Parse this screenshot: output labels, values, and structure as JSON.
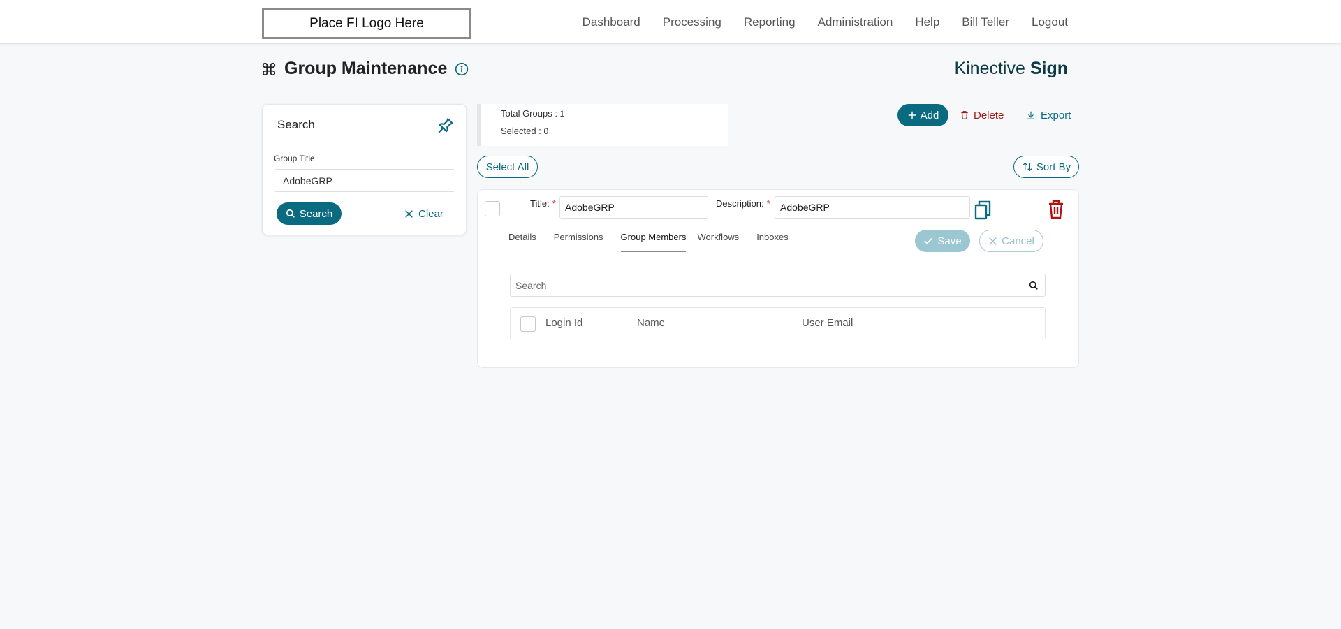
{
  "header": {
    "logo_text": "Place FI Logo Here",
    "nav": [
      "Dashboard",
      "Processing",
      "Reporting",
      "Administration",
      "Help",
      "Bill Teller",
      "Logout"
    ]
  },
  "page": {
    "title": "Group Maintenance",
    "brand_regular": "Kinective ",
    "brand_bold": "Sign"
  },
  "search_panel": {
    "heading": "Search",
    "field_label": "Group Title",
    "field_value": "AdobeGRP",
    "search_label": "Search",
    "clear_label": "Clear"
  },
  "summary": {
    "total_label": "Total Groups : ",
    "total_value": "1",
    "selected_label": "Selected : ",
    "selected_value": "0"
  },
  "actions": {
    "add_label": "Add",
    "delete_label": "Delete",
    "export_label": "Export",
    "select_all_label": "Select All",
    "sort_by_label": "Sort By"
  },
  "group": {
    "title_label": "Title:",
    "title_value": "AdobeGRP",
    "description_label": "Description:",
    "description_value": "AdobeGRP",
    "required_mark": "*",
    "tabs": [
      "Details",
      "Permissions",
      "Group Members",
      "Workflows",
      "Inboxes"
    ],
    "active_tab": "Group Members",
    "save_label": "Save",
    "cancel_label": "Cancel",
    "members_search_placeholder": "Search",
    "columns": [
      "Login Id",
      "Name",
      "User Email"
    ]
  },
  "colors": {
    "accent": "#0a6b80",
    "danger": "#a01a1a",
    "background": "#f6f8fa"
  }
}
